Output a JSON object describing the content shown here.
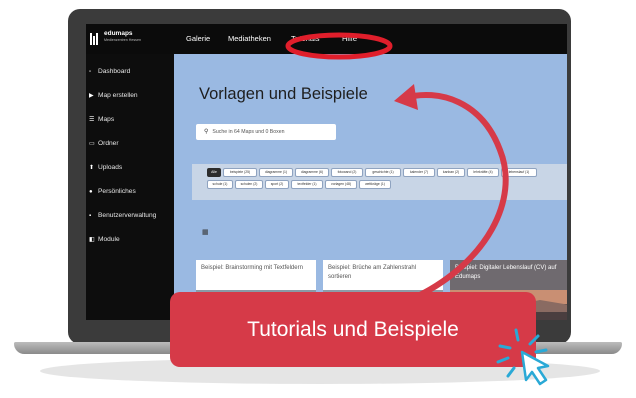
{
  "app": {
    "logo": "edumaps",
    "logo_sub": "Medienzentren Hessen"
  },
  "top_nav": [
    "Galerie",
    "Mediatheken",
    "Tutorials",
    "Hilfe"
  ],
  "sidebar": {
    "items": [
      {
        "label": "Dashboard",
        "icon": "dashboard-icon"
      },
      {
        "label": "Map erstellen",
        "icon": "play-icon"
      },
      {
        "label": "Maps",
        "icon": "maps-icon"
      },
      {
        "label": "Ordner",
        "icon": "folder-icon"
      },
      {
        "label": "Uploads",
        "icon": "upload-icon"
      },
      {
        "label": "Persönliches",
        "icon": "user-icon"
      },
      {
        "label": "Benutzerverwaltung",
        "icon": "users-icon"
      },
      {
        "label": "Module",
        "icon": "module-icon"
      }
    ]
  },
  "main": {
    "title": "Vorlagen und Beispiele",
    "search_placeholder": "Suche in 64 Maps und 0 Boxen",
    "filters": [
      "Alle",
      "beispiele (25)",
      "diagramme (1)",
      "diagramme (6)",
      "fotowand (2)",
      "geschichte (1)",
      "kalender (7)",
      "kanban (2)",
      "lehrkräfte (4)",
      "lebenslauf (1)",
      "schule (1)",
      "schulen (2)",
      "sport (2)",
      "textfelder (1)",
      "vorlagen (48)",
      "wettkräge (1)"
    ],
    "cards": [
      {
        "title": "Beispiel: Brainstorming mit Textfeldern"
      },
      {
        "title": "Beispiel: Brüche am Zahlenstrahl sortieren"
      },
      {
        "title": "Beispiel: Digitaler Lebenslauf (CV) auf Edumaps"
      }
    ]
  },
  "banner": {
    "text": "Tutorials und Beispiele"
  },
  "colors": {
    "banner": "#d63a48",
    "highlight": "#e01e2b",
    "content_bg": "#9ab9e2"
  }
}
